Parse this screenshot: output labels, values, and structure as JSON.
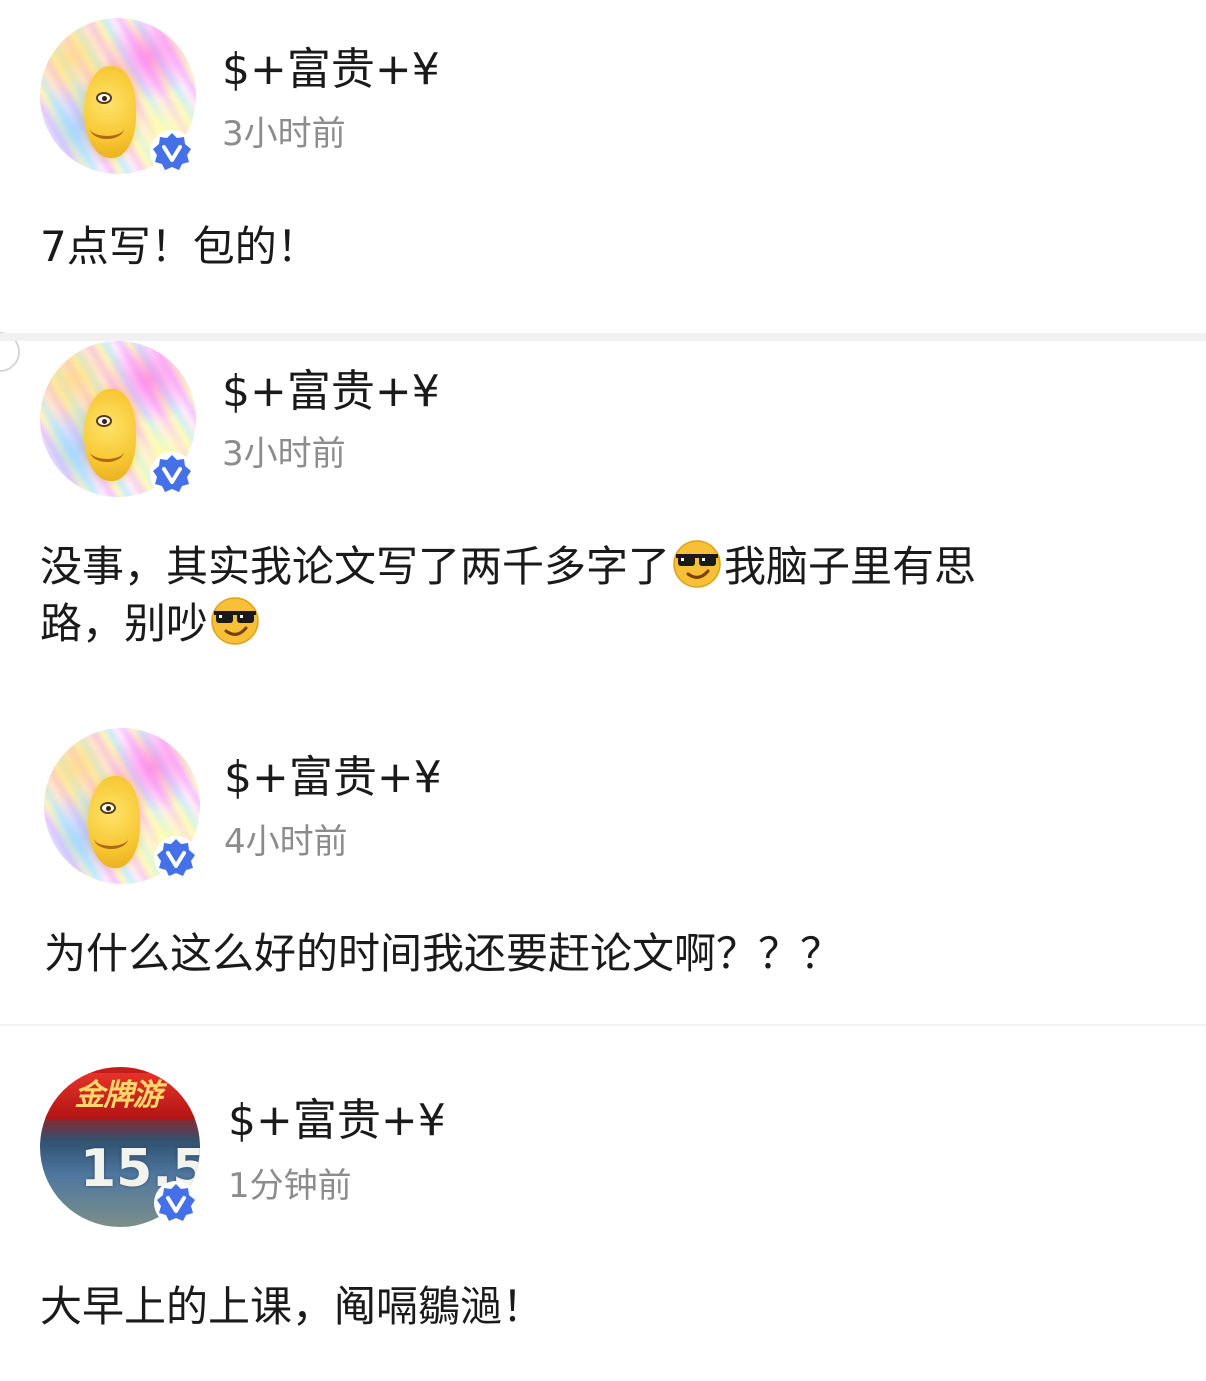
{
  "icons": {
    "verified": "verified-v-badge-icon",
    "cool_emoji": "sunglasses-emoji-icon"
  },
  "colors": {
    "verified_badge": "#4470e8",
    "timestamp": "#8c8c8c",
    "text": "#1a1a1a",
    "divider": "#f1f1f1"
  },
  "posts": [
    {
      "username": "$+富贵+¥",
      "time": "3小时前",
      "content": "7点写！包的！"
    },
    {
      "username": "$+富贵+¥",
      "time": "3小时前",
      "content_line1_a": "没事，其实我论文写了两千多字了",
      "content_line1_b": "我脑子里有思",
      "content_line2_a": "路，别吵"
    },
    {
      "username": "$+富贵+¥",
      "time": "4小时前",
      "content": "为什么这么好的时间我还要赶论文啊？？？"
    },
    {
      "username": "$+富贵+¥",
      "time": "1分钟前",
      "content": "大早上的上课，阄嗝鶵濄！",
      "avatar_banner": "金牌游",
      "avatar_number": "15.5"
    }
  ]
}
